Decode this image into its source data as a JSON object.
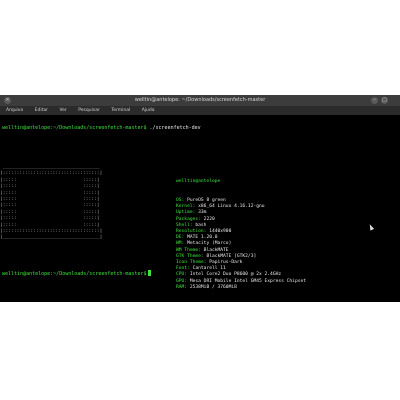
{
  "window": {
    "title": "welltin@antelope: ~/Downloads/screenfetch-master"
  },
  "menubar": {
    "items": [
      "Arquivo",
      "Editar",
      "Ver",
      "Pesquisar",
      "Terminal",
      "Ajuda"
    ]
  },
  "terminal": {
    "command_line": {
      "prompt": "welltin@antelope:~/Downloads/screenfetch-master$",
      "command": " ./screenfetch-dev"
    },
    "logo_lines": [
      " ___________________________________",
      "|:::::::::::::::::::::::::::::::::::|",
      "|:::::                        :::::|",
      "|:::::                        :::::|",
      "|:::::                        :::::|",
      "|:::::                        :::::|",
      "|:::::                        :::::|",
      "|:::::                        :::::|",
      "|:::::                        :::::|",
      "|:::::                        :::::|",
      "|:::::::::::::::::::::::::::::::::::|",
      "|___________________________________|"
    ],
    "info_header": "welltin@antelope",
    "info": [
      {
        "key": "OS:",
        "value": " PureOS 8 green"
      },
      {
        "key": "Kernel:",
        "value": " x86_64 Linux 4.16.12-gnu"
      },
      {
        "key": "Uptime:",
        "value": " 33m"
      },
      {
        "key": "Packages:",
        "value": " 2220"
      },
      {
        "key": "Shell:",
        "value": " bash"
      },
      {
        "key": "Resolution:",
        "value": " 1440x900"
      },
      {
        "key": "DE:",
        "value": " MATE 1.20.0"
      },
      {
        "key": "WM:",
        "value": " Metacity (Marco)"
      },
      {
        "key": "WM Theme:",
        "value": " BlackMATE"
      },
      {
        "key": "GTK Theme:",
        "value": " BlackMATE [GTK2/3]"
      },
      {
        "key": "Icon Theme:",
        "value": " Papirus-Dark"
      },
      {
        "key": "Font:",
        "value": " Cantarell 11"
      },
      {
        "key": "CPU:",
        "value": " Intel Core2 Duo P8600 @ 2x 2.4GHz"
      },
      {
        "key": "GPU:",
        "value": " Mesa DRI Mobile Intel GM45 Express Chipset"
      },
      {
        "key": "RAM:",
        "value": " 2538MiB / 3760MiB"
      }
    ],
    "final_prompt": "welltin@antelope:~/Downloads/screenfetch-master$"
  }
}
